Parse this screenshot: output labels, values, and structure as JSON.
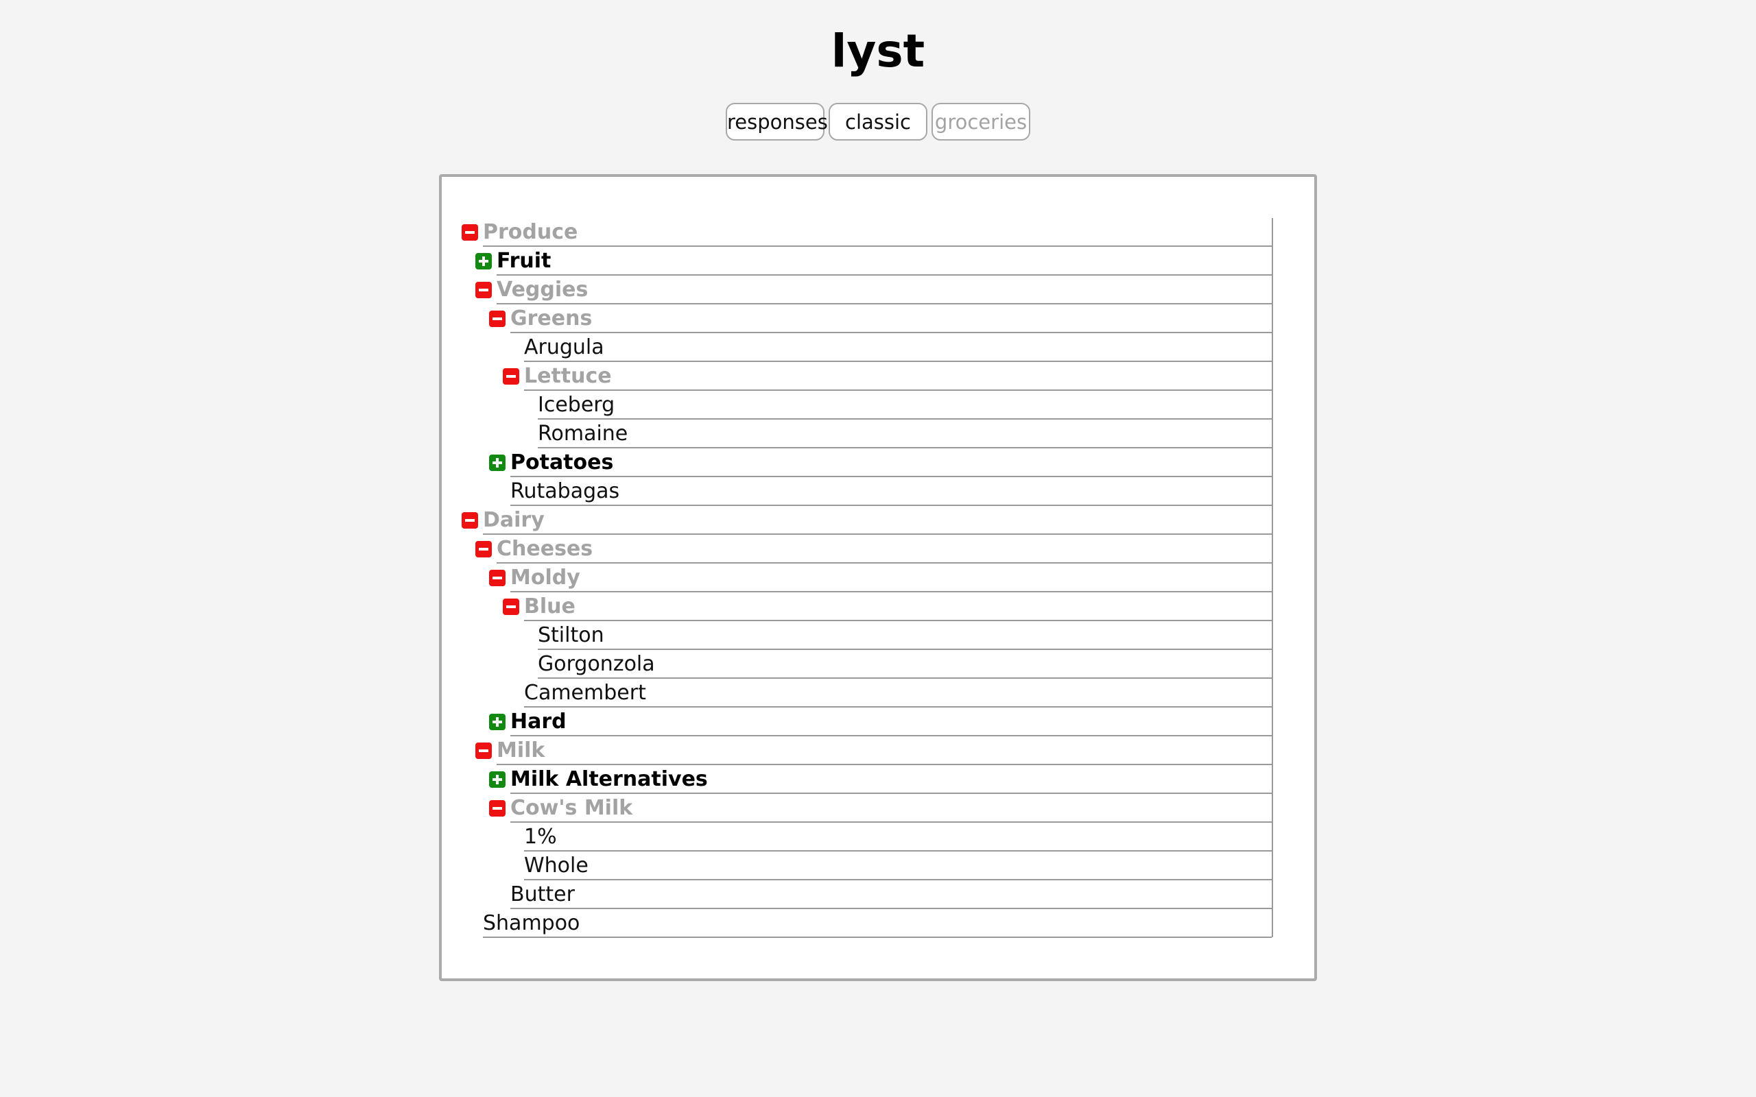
{
  "app": {
    "title": "lyst"
  },
  "tabs": [
    {
      "label": "responses",
      "active": false
    },
    {
      "label": "classic",
      "active": false
    },
    {
      "label": "groceries",
      "active": true
    }
  ],
  "colors": {
    "expand_toggle": "#128a12",
    "collapse_toggle": "#ee1111",
    "expanded_label": "#a3a3a3"
  },
  "tree": [
    {
      "label": "Produce",
      "depth": 0,
      "type": "group",
      "state": "expanded"
    },
    {
      "label": "Fruit",
      "depth": 1,
      "type": "group",
      "state": "collapsed"
    },
    {
      "label": "Veggies",
      "depth": 1,
      "type": "group",
      "state": "expanded"
    },
    {
      "label": "Greens",
      "depth": 2,
      "type": "group",
      "state": "expanded"
    },
    {
      "label": "Arugula",
      "depth": 3,
      "type": "item"
    },
    {
      "label": "Lettuce",
      "depth": 3,
      "type": "group",
      "state": "expanded"
    },
    {
      "label": "Iceberg",
      "depth": 4,
      "type": "item"
    },
    {
      "label": "Romaine",
      "depth": 4,
      "type": "item"
    },
    {
      "label": "Potatoes",
      "depth": 2,
      "type": "group",
      "state": "collapsed"
    },
    {
      "label": "Rutabagas",
      "depth": 2,
      "type": "item"
    },
    {
      "label": "Dairy",
      "depth": 0,
      "type": "group",
      "state": "expanded"
    },
    {
      "label": "Cheeses",
      "depth": 1,
      "type": "group",
      "state": "expanded"
    },
    {
      "label": "Moldy",
      "depth": 2,
      "type": "group",
      "state": "expanded"
    },
    {
      "label": "Blue",
      "depth": 3,
      "type": "group",
      "state": "expanded"
    },
    {
      "label": "Stilton",
      "depth": 4,
      "type": "item"
    },
    {
      "label": "Gorgonzola",
      "depth": 4,
      "type": "item"
    },
    {
      "label": "Camembert",
      "depth": 3,
      "type": "item"
    },
    {
      "label": "Hard",
      "depth": 2,
      "type": "group",
      "state": "collapsed"
    },
    {
      "label": "Milk",
      "depth": 1,
      "type": "group",
      "state": "expanded"
    },
    {
      "label": "Milk Alternatives",
      "depth": 2,
      "type": "group",
      "state": "collapsed"
    },
    {
      "label": "Cow's Milk",
      "depth": 2,
      "type": "group",
      "state": "expanded"
    },
    {
      "label": "1%",
      "depth": 3,
      "type": "item"
    },
    {
      "label": "Whole",
      "depth": 3,
      "type": "item"
    },
    {
      "label": "Butter",
      "depth": 2,
      "type": "item"
    },
    {
      "label": "Shampoo",
      "depth": 0,
      "type": "item"
    }
  ]
}
